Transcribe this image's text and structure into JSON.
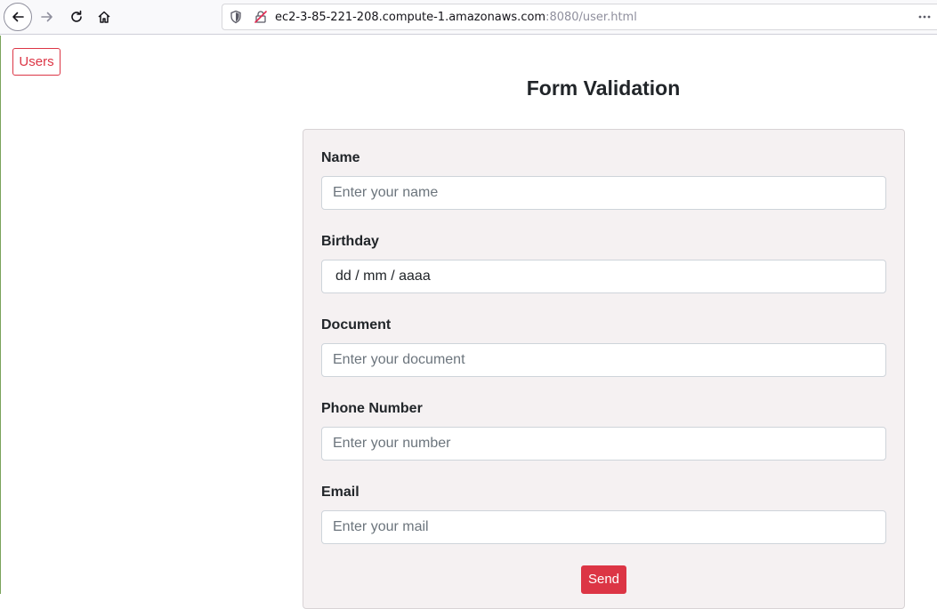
{
  "browser": {
    "url_host": "ec2-3-85-221-208.compute-1.amazonaws.com",
    "url_rest": ":8080/user.html",
    "icons": {
      "back": "back-arrow-icon",
      "forward": "forward-arrow-icon",
      "reload": "reload-icon",
      "home": "home-icon",
      "shield": "shield-icon",
      "insecure": "insecure-lock-icon",
      "page_actions": "ellipsis-icon"
    }
  },
  "header": {
    "users_button": "Users"
  },
  "main": {
    "title": "Form Validation",
    "fields": [
      {
        "label": "Name",
        "placeholder": "Enter your name"
      },
      {
        "label": "Birthday",
        "value": "dd / mm / aaaa"
      },
      {
        "label": "Document",
        "placeholder": "Enter your document"
      },
      {
        "label": "Phone Number",
        "placeholder": "Enter your number"
      },
      {
        "label": "Email",
        "placeholder": "Enter your mail"
      }
    ],
    "send_button": "Send"
  },
  "colors": {
    "accent": "#dc3545",
    "card_background": "#f5f1f2",
    "text": "#212529"
  }
}
